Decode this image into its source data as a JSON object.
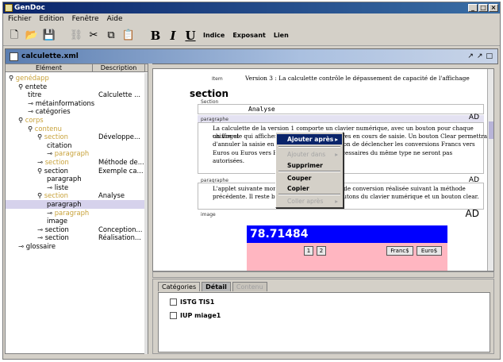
{
  "app": {
    "title": "GenDoc"
  },
  "window_buttons": [
    "_",
    "□",
    "×"
  ],
  "menu": [
    "Fichier",
    "Edition",
    "Fenêtre",
    "Aide"
  ],
  "toolbar": {
    "bold": "B",
    "italic": "I",
    "underline": "U",
    "indice": "Indice",
    "exposant": "Exposant",
    "lien": "Lien"
  },
  "document": {
    "name": "calculette.xml",
    "controls": [
      "↗",
      "↗",
      "□"
    ]
  },
  "tree": {
    "headers": [
      "Elément",
      "Description"
    ],
    "rows": [
      {
        "name": "genédapp",
        "desc": "",
        "style": "tan"
      },
      {
        "name": "entete",
        "desc": "",
        "style": "plain"
      },
      {
        "name": "titre",
        "desc": "Calculette ...",
        "style": "plain"
      },
      {
        "name": "métainformations",
        "desc": "",
        "style": "plain"
      },
      {
        "name": "catégories",
        "desc": "",
        "style": "plain"
      },
      {
        "name": "corps",
        "desc": "",
        "style": "tan"
      },
      {
        "name": "contenu",
        "desc": "",
        "style": "tan"
      },
      {
        "name": "section",
        "desc": "Développe...",
        "style": "tan"
      },
      {
        "name": "citation",
        "desc": "",
        "style": "plain"
      },
      {
        "name": "paragraph",
        "desc": "",
        "style": "tan"
      },
      {
        "name": "section",
        "desc": "Méthode de...",
        "style": "tan"
      },
      {
        "name": "section",
        "desc": "Exemple ca...",
        "style": "plain"
      },
      {
        "name": "paragraph",
        "desc": "",
        "style": "plain"
      },
      {
        "name": "liste",
        "desc": "",
        "style": "plain"
      },
      {
        "name": "section",
        "desc": "Analyse",
        "style": "tan"
      },
      {
        "name": "paragraph",
        "desc": "",
        "style": "plain"
      },
      {
        "name": "paragraph",
        "desc": "",
        "style": "tan"
      },
      {
        "name": "image",
        "desc": "",
        "style": "plain"
      },
      {
        "name": "section",
        "desc": "Conception...",
        "style": "plain"
      },
      {
        "name": "section",
        "desc": "Réalisation...",
        "style": "plain"
      },
      {
        "name": "glossaire",
        "desc": "",
        "style": "plain"
      }
    ]
  },
  "editor": {
    "item_label": "Item",
    "item_text": "Version 3 : La calculette contrôle le dépassement de capacité de l'affichage",
    "section_heading": "section",
    "section_label": "Section",
    "analyse": "Analyse",
    "paragraph_label": "paragraphe",
    "ad_marker": "AD",
    "para1_lines": [
      "La calculette de la version 1 comporte un clavier numérique, avec un bouton pour chaque chiffre et",
      "un virgule qui affichera directement les chiffres en cours de saisie. Un bouton Clear permettra",
      "d'annuler la saisie en cours. Ensuite, un bouton de déclencher les conversions Francs vers",
      "Euros ou Euros vers Francs, les fonctions nécessaires du même type ne seront pas",
      "autorisées."
    ],
    "para2_lines": [
      "L'applet suivante montre à l'écran la version de conversion réalisée suivant la méthode",
      "précédente. Il reste bien sûr à réaliser les boutons du clavier numérique et un bouton clear."
    ],
    "image_label": "image",
    "applet": {
      "display": "78.71484",
      "btn1": "1",
      "btn2": "2",
      "francs": "Franc$",
      "euros": "Euro$"
    }
  },
  "context_menu": {
    "items": [
      {
        "label": "Ajouter après",
        "state": "highlight",
        "submenu": true
      },
      {
        "label": "Ajouter dans",
        "state": "disabled",
        "submenu": true
      },
      {
        "label": "Supprimer",
        "state": "normal",
        "submenu": false
      },
      {
        "label": "Couper",
        "state": "normal",
        "submenu": false
      },
      {
        "label": "Copier",
        "state": "normal",
        "submenu": false
      },
      {
        "label": "Coller après",
        "state": "disabled",
        "submenu": true
      }
    ]
  },
  "bottom": {
    "tabs": [
      "Catégories",
      "Détail",
      "Contenu"
    ],
    "categories": [
      "ISTG TIS1",
      "IUP miage1"
    ]
  }
}
